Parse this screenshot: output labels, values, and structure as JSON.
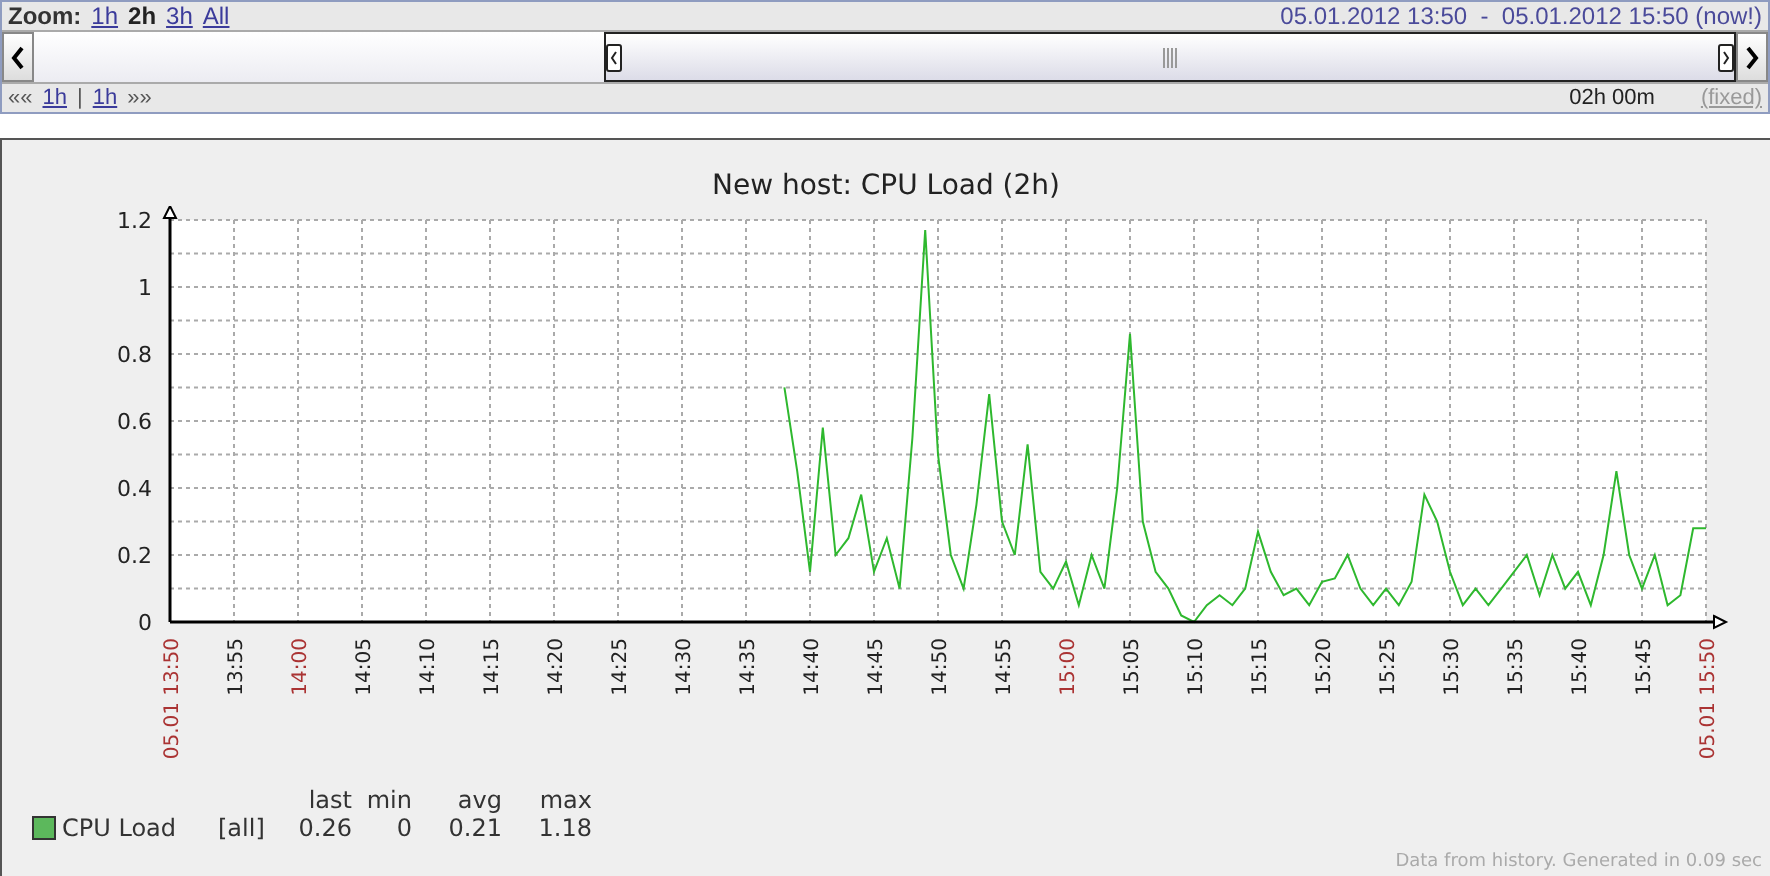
{
  "zoom": {
    "label": "Zoom:",
    "options": [
      {
        "label": "1h",
        "selected": false
      },
      {
        "label": "2h",
        "selected": true
      },
      {
        "label": "3h",
        "selected": false
      },
      {
        "label": "All",
        "selected": false
      }
    ]
  },
  "period": "05.01.2012 13:50  -  05.01.2012 15:50 (now!)",
  "navigation": {
    "back_far": "««",
    "back": "1h",
    "divider": "|",
    "forward": "1h",
    "forward_far": "»»",
    "duration": "02h 00m",
    "fixed": "(fixed)"
  },
  "graph": {
    "chart_data": {
      "type": "line",
      "title": "New host: CPU Load  (2h)",
      "grid": true,
      "x": [
        878,
        879,
        880,
        881,
        882,
        883,
        884,
        885,
        886,
        887,
        888,
        889,
        890,
        891,
        892,
        893,
        894,
        895,
        896,
        897,
        898,
        899,
        900,
        901,
        902,
        903,
        904,
        905,
        906,
        907,
        908,
        909,
        910,
        911,
        912,
        913,
        914,
        915,
        916,
        917,
        918,
        919,
        920,
        921,
        922,
        923,
        924,
        925,
        926,
        927,
        928,
        929,
        930,
        931,
        932,
        933,
        934,
        935,
        936,
        937,
        938,
        939,
        940,
        941,
        942,
        943,
        944,
        945,
        946,
        947,
        948,
        949,
        950
      ],
      "series": [
        {
          "name": "CPU Load",
          "color": "#2eb82e",
          "values": [
            0.7,
            0.45,
            0.15,
            0.58,
            0.2,
            0.25,
            0.38,
            0.15,
            0.25,
            0.1,
            0.55,
            1.17,
            0.5,
            0.2,
            0.1,
            0.35,
            0.68,
            0.3,
            0.2,
            0.53,
            0.15,
            0.1,
            0.18,
            0.05,
            0.2,
            0.1,
            0.4,
            0.86,
            0.3,
            0.15,
            0.1,
            0.02,
            0.0,
            0.05,
            0.08,
            0.05,
            0.1,
            0.27,
            0.15,
            0.08,
            0.1,
            0.05,
            0.12,
            0.13,
            0.2,
            0.1,
            0.05,
            0.1,
            0.05,
            0.12,
            0.38,
            0.3,
            0.15,
            0.05,
            0.1,
            0.05,
            0.1,
            0.15,
            0.2,
            0.08,
            0.2,
            0.1,
            0.15,
            0.05,
            0.2,
            0.45,
            0.2,
            0.1,
            0.2,
            0.05,
            0.08,
            0.28,
            0.28
          ]
        }
      ],
      "xlim": [
        830,
        950
      ],
      "ylim": [
        0,
        1.2
      ],
      "xticks": [
        {
          "value": 830,
          "label": "05.01 13:50"
        },
        {
          "value": 835,
          "label": "13:55"
        },
        {
          "value": 840,
          "label": "14:00"
        },
        {
          "value": 845,
          "label": "14:05"
        },
        {
          "value": 850,
          "label": "14:10"
        },
        {
          "value": 855,
          "label": "14:15"
        },
        {
          "value": 860,
          "label": "14:20"
        },
        {
          "value": 865,
          "label": "14:25"
        },
        {
          "value": 870,
          "label": "14:30"
        },
        {
          "value": 875,
          "label": "14:35"
        },
        {
          "value": 880,
          "label": "14:40"
        },
        {
          "value": 885,
          "label": "14:45"
        },
        {
          "value": 890,
          "label": "14:50"
        },
        {
          "value": 895,
          "label": "14:55"
        },
        {
          "value": 900,
          "label": "15:00"
        },
        {
          "value": 905,
          "label": "15:05"
        },
        {
          "value": 910,
          "label": "15:10"
        },
        {
          "value": 915,
          "label": "15:15"
        },
        {
          "value": 920,
          "label": "15:20"
        },
        {
          "value": 925,
          "label": "15:25"
        },
        {
          "value": 930,
          "label": "15:30"
        },
        {
          "value": 935,
          "label": "15:35"
        },
        {
          "value": 940,
          "label": "15:40"
        },
        {
          "value": 945,
          "label": "15:45"
        },
        {
          "value": 950,
          "label": "05.01 15:50"
        }
      ],
      "yticks": [
        0,
        0.2,
        0.4,
        0.6,
        0.8,
        1,
        1.2
      ]
    },
    "legend": {
      "columns": [
        "last",
        "min",
        "avg",
        "max"
      ],
      "items": [
        {
          "color": "#5cb85c",
          "function": "[all]",
          "values": [
            "0.26",
            "0",
            "0.21",
            "1.18"
          ]
        }
      ]
    },
    "footer": "Data from history. Generated in 0.09 sec"
  }
}
